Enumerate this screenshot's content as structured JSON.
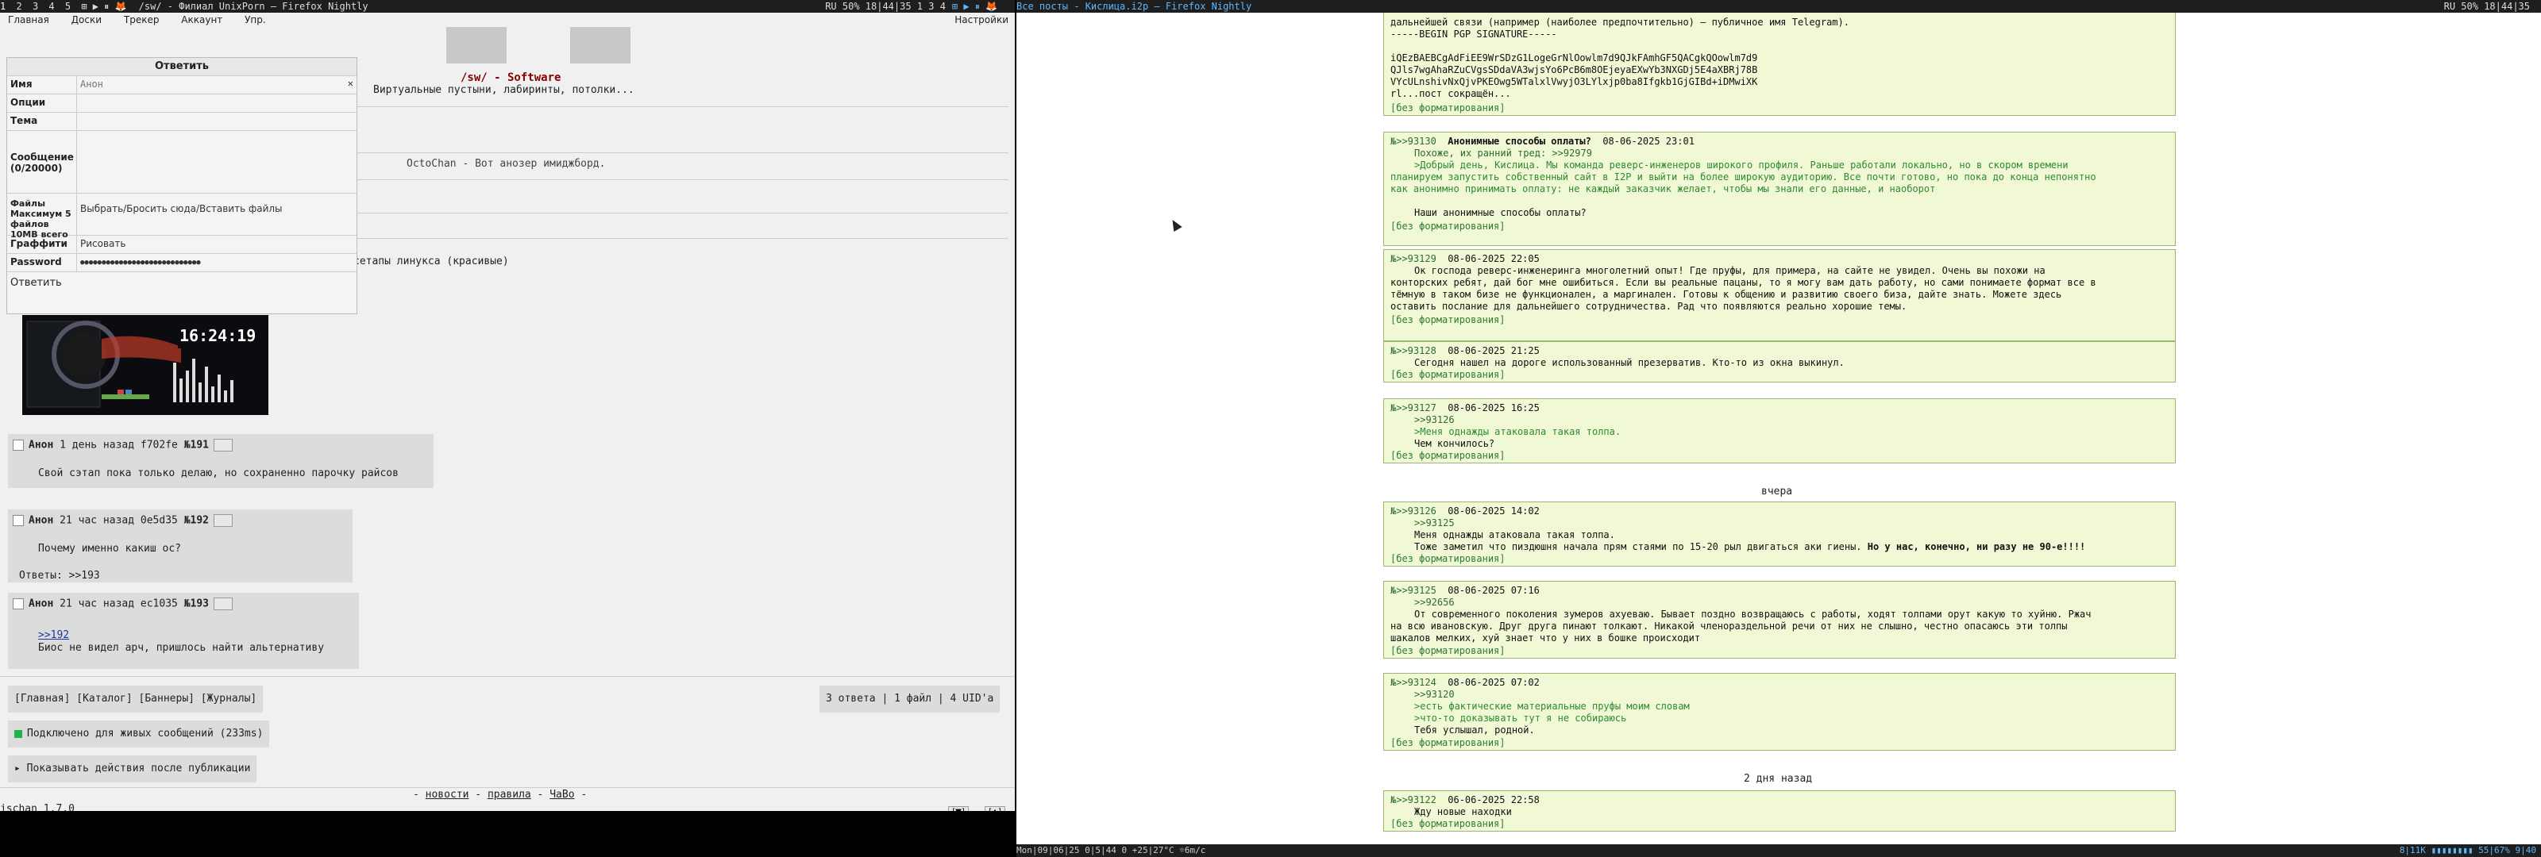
{
  "left_topbar": {
    "workspaces": [
      "1",
      "2",
      "3",
      "4",
      "5"
    ],
    "window_title": "/sw/ - Филиал UnixPorn — Firefox Nightly",
    "status": "RU 50% 18|44|35 1 3 4"
  },
  "right_topbar": {
    "window_title": "Все посты - Кислица.i2p — Firefox Nightly",
    "status": "RU 50% 18|44|35"
  },
  "nav": {
    "items": [
      "Главная",
      "Доски",
      "Трекер",
      "Аккаунт",
      "Упр."
    ],
    "settings": "Настройки"
  },
  "board": {
    "title": "/sw/ - Software",
    "subtitle": "Виртуальные пустыни, лабиринты, потолки...",
    "octochan": "OctoChan - Вот анозер имиджборд.",
    "setapy": "сетапы линукса (красивые)"
  },
  "reply_form": {
    "title": "Ответить",
    "name_label": "Имя",
    "name_placeholder": "Анон",
    "options_label": "Опции",
    "subject_label": "Тема",
    "message_label": "Сообщение (0/20000)",
    "files_label": "Файлы Максимум 5 файлов 10MB всего",
    "files_value": "Выбрать/Бросить сюда/Вставить файлы",
    "graffiti_label": "Граффити",
    "graffiti_value": "Рисовать",
    "password_label": "Password",
    "password_value": "●●●●●●●●●●●●●●●●●●●●●●●●●●●●",
    "submit": "Ответить"
  },
  "thumb": {
    "clock": "16:24:19"
  },
  "posts": [
    {
      "name": "Анон",
      "time": "1 день назад",
      "id": "f702fe",
      "num": "№191",
      "lines": [
        "Свой сэтап пока только делаю, но сохраненно парочку райсов"
      ]
    },
    {
      "name": "Анон",
      "time": "21 час назад",
      "id": "0e5d35",
      "num": "№192",
      "lines": [
        "Почему именно какиш ос?"
      ],
      "replies": "Ответы: >>193"
    },
    {
      "name": "Анон",
      "time": "21 час назад",
      "id": "ec1035",
      "num": "№193",
      "link": ">>192",
      "lines": [
        "Биос не видел арч, пришлось найти альтернативу"
      ]
    }
  ],
  "footer": {
    "links": "[Главная] [Каталог] [Баннеры] [Журналы]",
    "stats": "3 ответа | 1 файл | 4 UID'а",
    "live": "Подключено для живых сообщений (233ms)",
    "show_actions": "▸ Показывать действия после публикации",
    "news": "новости",
    "rules": "правила",
    "faq": "ЧаВо",
    "version_link": "jschan",
    "version": " 1.7.0",
    "prev": "[▼]",
    "next": "[▲]"
  },
  "feed": {
    "top_post": {
      "lines": [
        "дальнейшей связи (например (наиболее предпочтительно) — публичное имя Telegram).",
        "  -----BEGIN PGP SIGNATURE-----",
        "",
        "  iQEzBAEBCgAdFiEE9WrSDzG1LogeGrNlOowlm7d9QJkFAmhGF5QACgkQOowlm7d9",
        "  QJls7wgAhaRZuCVgsSDdaVA3wjsYo6PcB6m8OEjeyaEXwYb3NXGDj5E4aXBRj78B",
        "  VYcULnshivNxQjvPKEOwg5WTalxlVwyjO3LYlxjp0ba8Ifgkb1GjGIBd+iDMwiXK",
        "  rl...пост сокращён..."
      ],
      "format": "[без форматирования]"
    },
    "posts": [
      {
        "hdr": "№>>93130",
        "subject": "Анонимные способы оплаты?",
        "date": "08-06-2025 23:01",
        "lines": [
          {
            "t": "Похоже, их ранний тред: >>92979",
            "c": "ref"
          },
          {
            "t": ">Добрый день, Кислица. Мы команда реверс-инженеров широкого профиля. Раньше работали локально, но в скором времени",
            "c": "gt",
            "x": 0
          },
          {
            "t": "планируем запустить собственный сайт в I2P и выйти на более широкую аудиторию. Все почти готово, но пока до конца непонятно",
            "c": "gt",
            "x": 0
          },
          {
            "t": "как анонимно принимать оплату: не каждый заказчик желает, чтобы мы знали его данные, и наоборот",
            "c": "gt",
            "x": 0
          },
          {
            "t": "",
            "c": ""
          },
          {
            "t": "Наши анонимные способы оплаты?",
            "c": ""
          }
        ]
      },
      {
        "hdr": "№>>93129",
        "subject": "",
        "date": "08-06-2025 22:05",
        "lines": [
          {
            "t": "Ок господа реверс-инженеринга многолетний опыт! Где пруфы, для примера, на сайте не увидел. Очень вы похожи на",
            "c": "",
            "x": 0
          },
          {
            "t": "конторских ребят, дай бог мне ошибиться. Если вы реальные пацаны, то я могу вам дать работу, но сами понимаете формат все в",
            "c": "",
            "x": 0
          },
          {
            "t": "тёмную в таком бизе не функционален, а маргинален. Готовы к общению и развитию своего биза, дайте знать. Можете здесь",
            "c": "",
            "x": 0
          },
          {
            "t": "оставить послание для дальнейшего сотрудничества. Рад что появляются реально хорошие темы.",
            "c": "",
            "x": 0
          }
        ]
      },
      {
        "hdr": "№>>93128",
        "subject": "",
        "date": "08-06-2025 21:25",
        "lines": [
          {
            "t": "Сегодня нашел на дороге использованный презерватив. Кто-то из окна выкинул.",
            "c": ""
          }
        ]
      },
      {
        "hdr": "№>>93127",
        "subject": "",
        "date": "08-06-2025 16:25",
        "lines": [
          {
            "t": ">>93126",
            "c": "ref"
          },
          {
            "t": ">Меня однажды атаковала такая толпа.",
            "c": "gt"
          },
          {
            "t": "Чем кончилось?",
            "c": ""
          }
        ]
      },
      {
        "hdr": "№>>93126",
        "subject": "",
        "date": "08-06-2025 14:02",
        "lines": [
          {
            "t": ">>93125",
            "c": "ref"
          },
          {
            "t": "Меня однажды атаковала такая толпа.",
            "c": ""
          },
          {
            "t": "Тоже заметил что пиздюшня начала прям стаями по 15-20 рыл двигаться аки гиены. ",
            "c": "",
            "bold": "Но у нас, конечно, ни разу не 90-е!!!!"
          }
        ]
      },
      {
        "hdr": "№>>93125",
        "subject": "",
        "date": "08-06-2025 07:16",
        "lines": [
          {
            "t": ">>92656",
            "c": "ref"
          },
          {
            "t": "От современного поколения зумеров ахуеваю. Бывает поздно возвращаюсь с работы, ходят толпами орут какую то хуйню. Ржач",
            "c": ""
          },
          {
            "t": "на всю ивановскую. Друг друга пинают толкают. Никакой членораздельной речи от них не слышно, честно опасаюсь эти толпы",
            "c": "",
            "x": 0
          },
          {
            "t": "шакалов мелких, хуй знает что у них в бошке происходит",
            "c": "",
            "x": 0
          }
        ]
      },
      {
        "hdr": "№>>93124",
        "subject": "",
        "date": "08-06-2025 07:02",
        "lines": [
          {
            "t": ">>93120",
            "c": "ref"
          },
          {
            "t": ">есть фактические материальные пруфы моим словам",
            "c": "gt"
          },
          {
            "t": ">что-то доказывать тут я не собираюсь",
            "c": "gt"
          },
          {
            "t": "Тебя услышал, родной.",
            "c": ""
          }
        ]
      },
      {
        "hdr": "№>>93122",
        "subject": "",
        "date": "06-06-2025 22:58",
        "lines": [
          {
            "t": "Жду новые находки",
            "c": ""
          }
        ]
      }
    ],
    "format": "[без форматирования]",
    "day_yesterday": "вчера",
    "day_2": "2 дня назад"
  },
  "bottom_right": {
    "left": "Mon|09|06|25 0|5|44 0 +25|27°C ☼6m/c",
    "right": "8|11K ▮▮▮▮▮▮▮▮ 55|67% 9|40"
  }
}
